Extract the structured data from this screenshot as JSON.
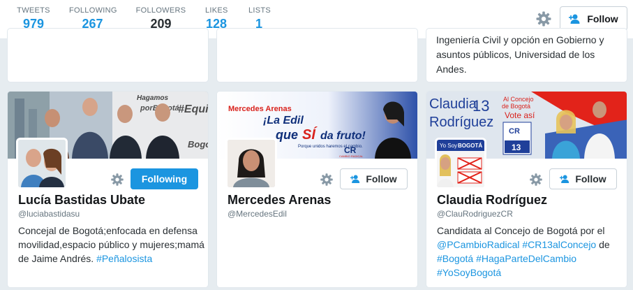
{
  "nav": {
    "stats": [
      {
        "label": "TWEETS",
        "value": "979"
      },
      {
        "label": "FOLLOWING",
        "value": "267"
      },
      {
        "label": "FOLLOWERS",
        "value": "209"
      },
      {
        "label": "LIKES",
        "value": "128"
      },
      {
        "label": "LISTS",
        "value": "1"
      }
    ],
    "active_stat": "FOLLOWERS",
    "follow_label": "Follow"
  },
  "previous_row": {
    "right_card_bio": "Ingeniería Civil y opción en Gobierno y asuntos públicos, Universidad de los Andes."
  },
  "cards": [
    {
      "name": "Lucía Bastidas Ubate",
      "handle": "@luciabastidasu",
      "button_label": "Following",
      "button_state": "following",
      "bio": [
        "Concejal de Bogotá;enfocada en defensa movilidad,espacio público y mujeres;mamá de Jaime Andrés. ",
        {
          "tag": "#Peñalosista"
        }
      ],
      "banner_text": [
        "Hagamos",
        "#Equipo",
        "porBogotá",
        "Bogotá"
      ]
    },
    {
      "name": "Mercedes Arenas",
      "handle": "@MercedesEdil",
      "button_label": "Follow",
      "button_state": "follow",
      "bio": [],
      "banner_text": [
        "Mercedes Arenas",
        "¡La Edil",
        "que",
        "SÍ",
        "da fruto!",
        "Porque unidos haremos el cambio.",
        "CR",
        "CAMBIO RADICAL"
      ]
    },
    {
      "name": "Claudia Rodríguez",
      "handle": "@ClauRodriguezCR",
      "button_label": "Follow",
      "button_state": "follow",
      "bio": [
        "Candidata al Concejo de Bogotá por el ",
        {
          "tag": "@PCambioRadical"
        },
        " ",
        {
          "tag": "#CR13alConcejo"
        },
        " de ",
        {
          "tag": "#Bogotá"
        },
        " ",
        {
          "tag": "#HagaParteDelCambio"
        },
        " ",
        {
          "tag": "#YoSoyBogotá"
        }
      ],
      "banner_text": [
        "Claudia",
        "Rodríguez",
        "13",
        "Al Concejo",
        "de Bogotá",
        "Vote así",
        "CR",
        "13",
        "Yo Soy",
        "BOGOTÁ"
      ]
    }
  ],
  "colors": {
    "accent": "#1b95e0",
    "page_bg": "#e6ecf0",
    "text": "#292f33",
    "muted": "#66757f",
    "cr_red": "#e2231a",
    "cr_blue": "#003da5"
  },
  "icons": {
    "gear": "gear-icon",
    "follow": "person-add-icon"
  }
}
